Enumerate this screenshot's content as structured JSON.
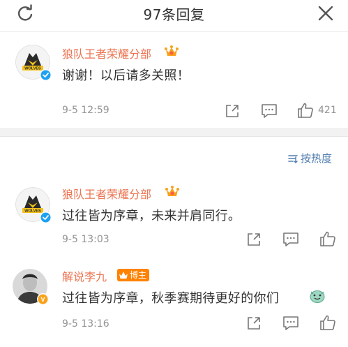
{
  "header": {
    "title": "97条回复"
  },
  "top_comment": {
    "author": "狼队王者荣耀分部",
    "text": "谢谢！以后请多关照！",
    "time": "9-5 12:59",
    "like_count": "421"
  },
  "sort": {
    "label": "按热度"
  },
  "replies": [
    {
      "author": "狼队王者荣耀分部",
      "text": "过往皆为序章，未来并肩同行。",
      "time": "9-5 13:03"
    },
    {
      "author": "解说李九",
      "badge": "博主",
      "text": "过往皆为序章，秋季赛期待更好的你们",
      "time": "9-5 13:16"
    }
  ],
  "colors": {
    "name": "#eb7350",
    "link": "#507daf",
    "meta": "#939393",
    "verified": "#1da1f2",
    "badge": "#ff8200"
  }
}
